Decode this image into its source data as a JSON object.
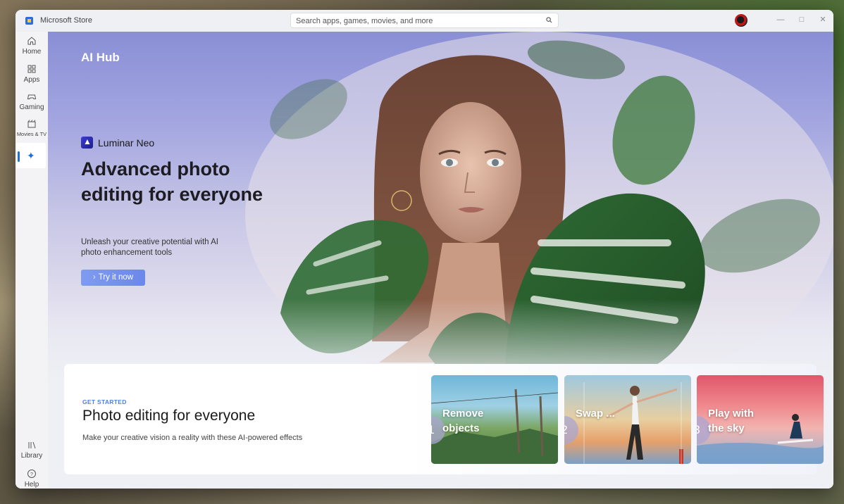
{
  "window": {
    "app_title": "Microsoft Store",
    "search_placeholder": "Search apps, games, movies, and more"
  },
  "nav": {
    "items": [
      {
        "label": "Home",
        "icon": "home-icon"
      },
      {
        "label": "Apps",
        "icon": "apps-icon"
      },
      {
        "label": "Gaming",
        "icon": "gaming-icon"
      },
      {
        "label": "Movies & TV",
        "icon": "movies-icon"
      },
      {
        "label": "",
        "icon": "ai-hub-icon",
        "active": true
      }
    ],
    "bottom": [
      {
        "label": "Library",
        "icon": "library-icon"
      },
      {
        "label": "Help",
        "icon": "help-icon"
      }
    ]
  },
  "hero": {
    "page_title": "AI Hub",
    "brand": "Luminar Neo",
    "headline": "Advanced photo editing for everyone",
    "subline": "Unleash your creative potential with AI photo enhancement tools",
    "cta_label": "Try it now"
  },
  "get_started": {
    "eyebrow": "GET STARTED",
    "title": "Photo editing for everyone",
    "subtitle": "Make your creative vision a reality with these AI-powered effects",
    "steps": [
      {
        "number": "1",
        "label": "Remove objects"
      },
      {
        "number": "2",
        "label": "Swap ..."
      },
      {
        "number": "3",
        "label": "Play with the sky"
      }
    ]
  },
  "colors": {
    "accent": "#1f6fd8",
    "cta": "#7290ec"
  }
}
